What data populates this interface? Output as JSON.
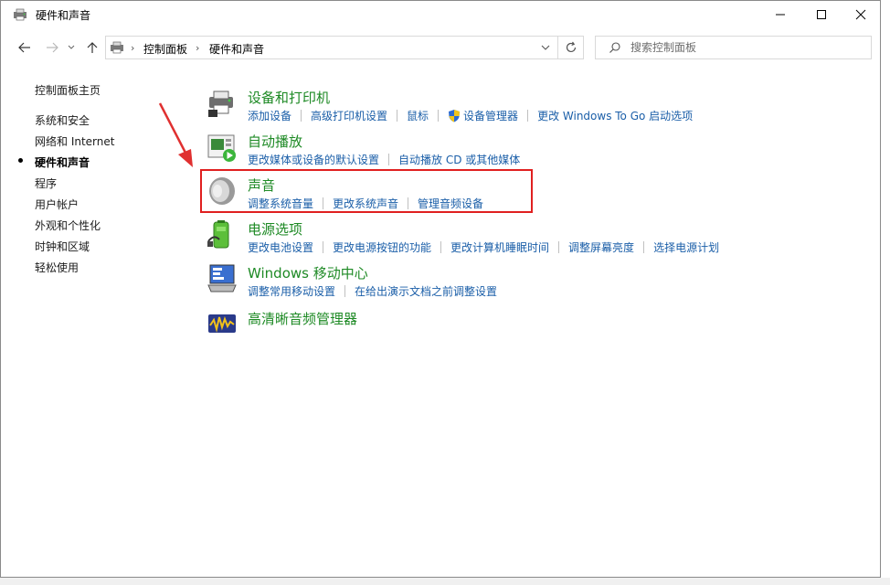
{
  "window": {
    "title": "硬件和声音"
  },
  "address": {
    "crumbs": [
      "控制面板",
      "硬件和声音"
    ],
    "search_placeholder": "搜索控制面板"
  },
  "leftnav": {
    "items": [
      "控制面板主页",
      "系统和安全",
      "网络和 Internet",
      "硬件和声音",
      "程序",
      "用户帐户",
      "外观和个性化",
      "时钟和区域",
      "轻松使用"
    ],
    "current": "硬件和声音"
  },
  "categories": [
    {
      "title": "设备和打印机",
      "links": [
        "添加设备",
        "高级打印机设置",
        "鼠标",
        "设备管理器",
        "更改 Windows To Go 启动选项"
      ]
    },
    {
      "title": "自动播放",
      "links": [
        "更改媒体或设备的默认设置",
        "自动播放 CD 或其他媒体"
      ]
    },
    {
      "title": "声音",
      "links": [
        "调整系统音量",
        "更改系统声音",
        "管理音频设备"
      ]
    },
    {
      "title": "电源选项",
      "links": [
        "更改电池设置",
        "更改电源按钮的功能",
        "更改计算机睡眠时间",
        "调整屏幕亮度",
        "选择电源计划"
      ]
    },
    {
      "title": "Windows 移动中心",
      "links": [
        "调整常用移动设置",
        "在给出演示文档之前调整设置"
      ]
    },
    {
      "title": "高清晰音频管理器",
      "links": []
    }
  ],
  "colors": {
    "accent_green": "#1e8a25",
    "link_blue": "#1a5ea8",
    "highlight_red": "#e02020"
  }
}
